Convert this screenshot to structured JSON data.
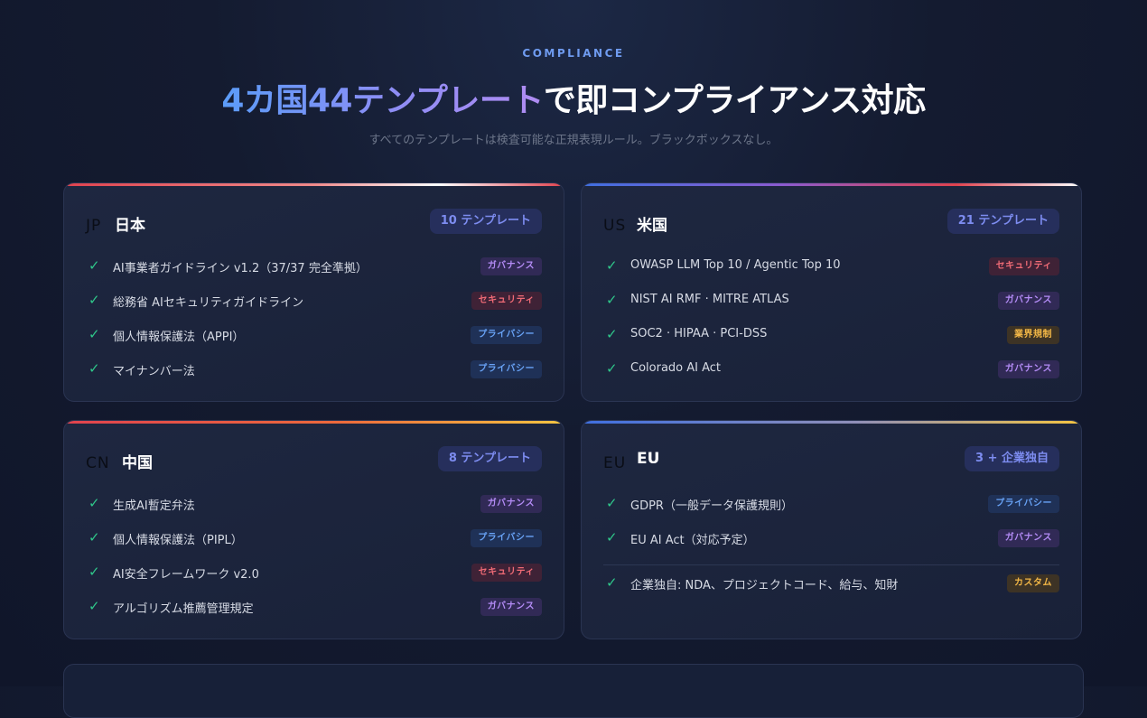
{
  "header": {
    "eyebrow": "COMPLIANCE",
    "headline_highlight": "4カ国44テンプレート",
    "headline_rest": "で即コンプライアンス対応",
    "subtitle": "すべてのテンプレートは検査可能な正規表現ルール。ブラックボックスなし。"
  },
  "tag_colors": {
    "governance": "#b38bf5",
    "security": "#f06b76",
    "privacy": "#68a2f5",
    "industry": "#f1b646",
    "custom": "#f1b646",
    "check": "#2fc78a"
  },
  "cards": [
    {
      "code": "JP",
      "name": "日本",
      "badge": "10 テンプレート",
      "items": [
        {
          "label": "AI事業者ガイドライン v1.2（37/37 完全準拠）",
          "tag": "ガバナンス"
        },
        {
          "label": "総務省 AIセキュリティガイドライン",
          "tag": "セキュリティ"
        },
        {
          "label": "個人情報保護法（APPI）",
          "tag": "プライバシー"
        },
        {
          "label": "マイナンバー法",
          "tag": "プライバシー"
        }
      ]
    },
    {
      "code": "US",
      "name": "米国",
      "badge": "21 テンプレート",
      "items": [
        {
          "label": "OWASP LLM Top 10 / Agentic Top 10",
          "tag": "セキュリティ"
        },
        {
          "label": "NIST AI RMF · MITRE ATLAS",
          "tag": "ガバナンス"
        },
        {
          "label": "SOC2 · HIPAA · PCI-DSS",
          "tag": "業界規制"
        },
        {
          "label": "Colorado AI Act",
          "tag": "ガバナンス"
        }
      ]
    },
    {
      "code": "CN",
      "name": "中国",
      "badge": "8 テンプレート",
      "items": [
        {
          "label": "生成AI暫定弁法",
          "tag": "ガバナンス"
        },
        {
          "label": "個人情報保護法（PIPL）",
          "tag": "プライバシー"
        },
        {
          "label": "AI安全フレームワーク v2.0",
          "tag": "セキュリティ"
        },
        {
          "label": "アルゴリズム推薦管理規定",
          "tag": "ガバナンス"
        }
      ]
    },
    {
      "code": "EU",
      "name": "EU",
      "badge": "3 + 企業独自",
      "items": [
        {
          "label": "GDPR（一般データ保護規則）",
          "tag": "プライバシー"
        },
        {
          "label": "EU AI Act（対応予定）",
          "tag": "ガバナンス"
        },
        {
          "label": "企業独自: NDA、プロジェクトコード、給与、知財",
          "tag": "カスタム"
        }
      ]
    }
  ]
}
